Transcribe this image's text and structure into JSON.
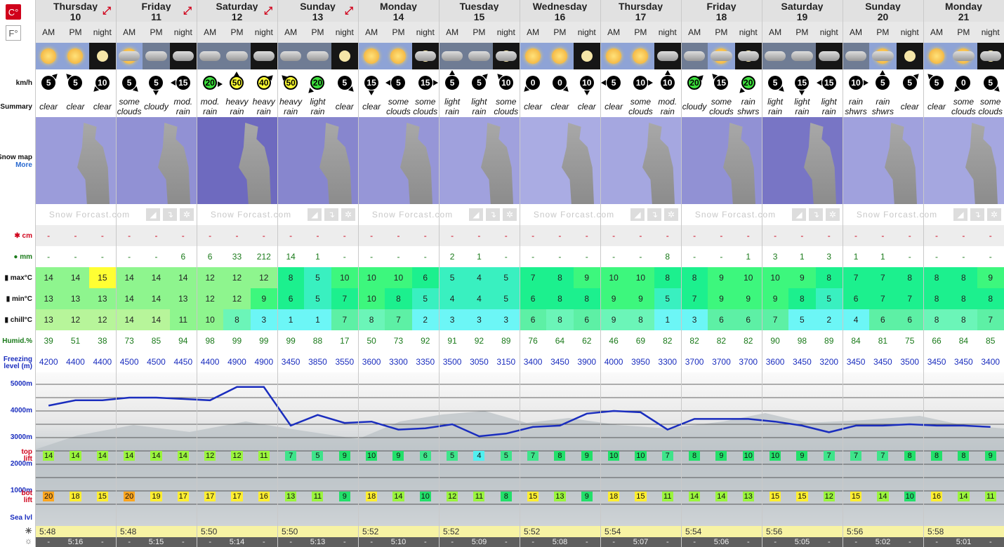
{
  "units": {
    "celsius": "C°",
    "fahrenheit": "F°"
  },
  "labels": {
    "wind": "km/h",
    "summary": "Summary",
    "snowmap": "Snow map",
    "more": "More",
    "snow": "cm",
    "rain": "mm",
    "max": "max°C",
    "min": "min°C",
    "chill": "chill°C",
    "humid": "Humid.%",
    "freeze1": "Freezing",
    "freeze2": "level (m)",
    "toplift1": "top",
    "toplift2": "lift",
    "botlift1": "bot",
    "botlift2": "lift",
    "sealvl": "Sea lvl"
  },
  "alt_labels": [
    "5000m",
    "4000m",
    "3000m",
    "2000m",
    "1000m"
  ],
  "periods": [
    "AM",
    "PM",
    "night"
  ],
  "days": [
    {
      "name": "Thursday",
      "date": "10"
    },
    {
      "name": "Friday",
      "date": "11"
    },
    {
      "name": "Saturday",
      "date": "12"
    },
    {
      "name": "Sunday",
      "date": "13"
    },
    {
      "name": "Monday",
      "date": "14"
    },
    {
      "name": "Tuesday",
      "date": "15"
    },
    {
      "name": "Wednesday",
      "date": "16"
    },
    {
      "name": "Thursday",
      "date": "17"
    },
    {
      "name": "Friday",
      "date": "18"
    },
    {
      "name": "Saturday",
      "date": "19"
    },
    {
      "name": "Sunday",
      "date": "20"
    },
    {
      "name": "Monday",
      "date": "21"
    }
  ],
  "weather_icons": [
    "sun",
    "sun",
    "moon",
    "sun-cloud",
    "cloud",
    "cloud",
    "cloud",
    "cloud",
    "cloud",
    "cloud",
    "cloud",
    "moon",
    "sun",
    "sun",
    "moon-cloud",
    "cloud",
    "cloud",
    "moon-cloud",
    "sun",
    "sun",
    "moon",
    "sun",
    "sun",
    "cloud",
    "cloud",
    "sun-cloud",
    "moon-cloud",
    "cloud",
    "cloud",
    "cloud",
    "cloud",
    "sun-cloud",
    "moon",
    "sun",
    "sun-cloud",
    "moon-cloud"
  ],
  "wind": [
    5,
    5,
    10,
    5,
    5,
    15,
    20,
    50,
    40,
    50,
    20,
    5,
    15,
    5,
    15,
    5,
    5,
    10,
    0,
    0,
    10,
    5,
    10,
    10,
    20,
    15,
    20,
    5,
    15,
    15,
    10,
    5,
    5,
    5,
    0,
    5
  ],
  "summary": [
    "clear",
    "clear",
    "clear",
    "some clouds",
    "cloudy",
    "mod. rain",
    "mod. rain",
    "heavy rain",
    "heavy rain",
    "heavy rain",
    "light rain",
    "clear",
    "clear",
    "some clouds",
    "some clouds",
    "light rain",
    "light rain",
    "some clouds",
    "clear",
    "clear",
    "clear",
    "clear",
    "some clouds",
    "mod. rain",
    "cloudy",
    "some clouds",
    "rain shwrs",
    "light rain",
    "light rain",
    "light rain",
    "rain shwrs",
    "rain shwrs",
    "clear",
    "clear",
    "some clouds",
    "some clouds"
  ],
  "snowmap_watermark": "Snow Forcast.com",
  "snow": [
    "-",
    "-",
    "-",
    "-",
    "-",
    "-",
    "-",
    "-",
    "-",
    "-",
    "-",
    "-",
    "-",
    "-",
    "-",
    "-",
    "-",
    "-",
    "-",
    "-",
    "-",
    "-",
    "-",
    "-",
    "-",
    "-",
    "-",
    "-",
    "-",
    "-",
    "-",
    "-",
    "-",
    "-",
    "-",
    "-"
  ],
  "rain": [
    "-",
    "-",
    "-",
    "-",
    "-",
    "6",
    "6",
    "33",
    "212",
    "14",
    "1",
    "-",
    "-",
    "-",
    "-",
    "2",
    "1",
    "-",
    "-",
    "-",
    "-",
    "-",
    "-",
    "8",
    "-",
    "-",
    "1",
    "3",
    "1",
    "3",
    "1",
    "1",
    "-",
    "-",
    "-",
    "-"
  ],
  "max": [
    14,
    14,
    15,
    14,
    14,
    14,
    12,
    12,
    12,
    8,
    5,
    10,
    10,
    10,
    6,
    5,
    4,
    5,
    7,
    8,
    9,
    10,
    10,
    8,
    8,
    9,
    10,
    10,
    9,
    8,
    7,
    7,
    8,
    8,
    8,
    9
  ],
  "min": [
    13,
    13,
    13,
    14,
    14,
    13,
    12,
    12,
    9,
    6,
    5,
    7,
    10,
    8,
    5,
    4,
    4,
    5,
    6,
    8,
    8,
    9,
    9,
    5,
    7,
    9,
    9,
    9,
    8,
    5,
    6,
    7,
    7,
    8,
    8,
    8
  ],
  "chill": [
    13,
    12,
    12,
    14,
    14,
    11,
    10,
    8,
    3,
    1,
    1,
    7,
    8,
    7,
    2,
    3,
    3,
    3,
    6,
    8,
    6,
    9,
    8,
    1,
    3,
    6,
    6,
    7,
    5,
    2,
    4,
    6,
    6,
    8,
    8,
    7
  ],
  "humid": [
    39,
    51,
    38,
    73,
    85,
    94,
    98,
    99,
    99,
    99,
    88,
    17,
    50,
    73,
    92,
    91,
    92,
    89,
    76,
    64,
    62,
    46,
    69,
    82,
    82,
    82,
    82,
    90,
    98,
    89,
    84,
    81,
    75,
    66,
    84,
    85
  ],
  "freeze": [
    4200,
    4400,
    4400,
    4500,
    4500,
    4450,
    4400,
    4900,
    4900,
    3450,
    3850,
    3550,
    3600,
    3300,
    3350,
    3500,
    3050,
    3150,
    3400,
    3450,
    3900,
    4000,
    3950,
    3300,
    3700,
    3700,
    3700,
    3600,
    3450,
    3200,
    3450,
    3450,
    3500,
    3450,
    3450,
    3400
  ],
  "toplift": [
    14,
    14,
    14,
    14,
    14,
    14,
    12,
    12,
    11,
    7,
    5,
    9,
    10,
    9,
    6,
    5,
    4,
    5,
    7,
    8,
    9,
    10,
    10,
    7,
    8,
    9,
    10,
    10,
    9,
    7,
    7,
    7,
    8,
    8,
    8,
    9
  ],
  "botlift": [
    20,
    18,
    15,
    20,
    19,
    17,
    17,
    17,
    16,
    13,
    11,
    9,
    18,
    14,
    10,
    12,
    11,
    8,
    15,
    13,
    9,
    18,
    15,
    11,
    14,
    14,
    13,
    15,
    15,
    12,
    15,
    14,
    10,
    16,
    14,
    11
  ],
  "sunrise": [
    "5:48",
    "5:48",
    "5:50",
    "5:50",
    "5:52",
    "5:52",
    "5:52",
    "5:54",
    "5:54",
    "5:56",
    "5:56",
    "5:58"
  ],
  "sunset": [
    "5:16",
    "5:15",
    "5:14",
    "5:13",
    "5:10",
    "5:09",
    "5:08",
    "5:07",
    "5:06",
    "5:05",
    "5:02",
    "5:01"
  ],
  "dash": "-",
  "colors": {
    "accent": "#d0021b",
    "blue": "#1a2dbe",
    "green": "#1a7a1a"
  }
}
